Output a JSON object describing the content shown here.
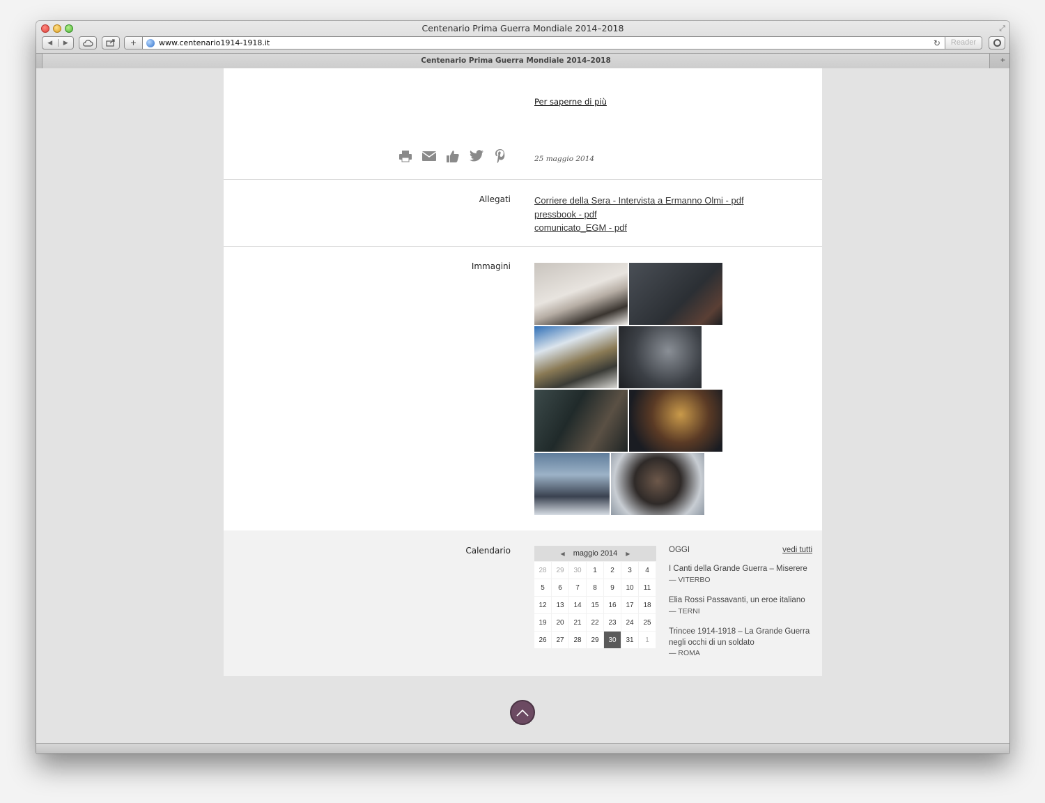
{
  "window": {
    "title": "Centenario Prima Guerra Mondiale 2014–2018",
    "url": "www.centenario1914-1918.it",
    "reader_label": "Reader",
    "tab_title": "Centenario Prima Guerra Mondiale 2014–2018"
  },
  "article": {
    "more_link": "Per saperne di più",
    "date": "25 maggio 2014",
    "share_icons": [
      "print-icon",
      "email-icon",
      "like-icon",
      "twitter-icon",
      "pinterest-icon"
    ]
  },
  "attachments": {
    "label": "Allegati",
    "items": [
      "Corriere della Sera - Intervista a Ermanno Olmi - pdf",
      "pressbook - pdf",
      "comunicato_EGM - pdf"
    ]
  },
  "images": {
    "label": "Immagini"
  },
  "calendar": {
    "label": "Calendario",
    "month": "maggio 2014",
    "weeks": [
      [
        "28",
        "29",
        "30",
        "1",
        "2",
        "3",
        "4"
      ],
      [
        "5",
        "6",
        "7",
        "8",
        "9",
        "10",
        "11"
      ],
      [
        "12",
        "13",
        "14",
        "15",
        "16",
        "17",
        "18"
      ],
      [
        "19",
        "20",
        "21",
        "22",
        "23",
        "24",
        "25"
      ],
      [
        "26",
        "27",
        "28",
        "29",
        "30",
        "31",
        "1"
      ]
    ],
    "selected_day": "30"
  },
  "events": {
    "today_label": "OGGI",
    "see_all": "vedi tutti",
    "items": [
      {
        "title": "I Canti della Grande Guerra – Miserere",
        "place": "— VITERBO"
      },
      {
        "title": "Elia Rossi Passavanti, un eroe italiano",
        "place": "— TERNI"
      },
      {
        "title": "Trincee 1914-1918 – La Grande Guerra negli occhi di un soldato",
        "place": "— ROMA"
      }
    ]
  },
  "colors": {
    "accent": "#6c4a62",
    "selected_day": "#5a5a5a"
  }
}
